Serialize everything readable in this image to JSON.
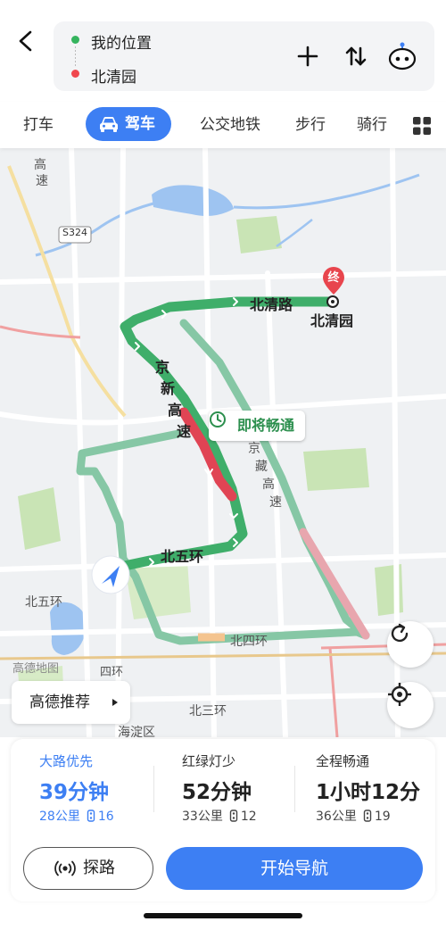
{
  "header": {
    "start": "我的位置",
    "end": "北清园"
  },
  "tabs": [
    {
      "label": "打车"
    },
    {
      "label": "驾车",
      "active": true
    },
    {
      "label": "公交地铁"
    },
    {
      "label": "步行"
    },
    {
      "label": "骑行"
    }
  ],
  "map": {
    "road_beiqing": "北清路",
    "destination": "北清园",
    "destination_marker": "终",
    "road_jingxin": [
      "京",
      "新",
      "高",
      "速"
    ],
    "road_jingzang": [
      "京",
      "藏",
      "高",
      "速"
    ],
    "road_beiwuhuan": "北五环",
    "road_beiwuhuan_left": "北五环",
    "road_beisihuan": "北四环",
    "road_beisanhuan": "北三环",
    "haidian": "海淀区",
    "sihuan_short": "四环",
    "expressway_top": [
      "高",
      "速"
    ],
    "s324": "S324",
    "watermark": "高德地图",
    "soon_clear": "即将畅通",
    "recommend": "高德推荐"
  },
  "routes": [
    {
      "name": "大路优先",
      "time": "39分钟",
      "distance": "28公里",
      "lights": "16",
      "selected": true
    },
    {
      "name": "红绿灯少",
      "time": "52分钟",
      "distance": "33公里",
      "lights": "12"
    },
    {
      "name": "全程畅通",
      "time": "1小时12分",
      "distance": "36公里",
      "lights": "19"
    }
  ],
  "actions": {
    "explore": "探路",
    "start_nav": "开始导航"
  },
  "colors": {
    "accent": "#3d7ff3",
    "route_green": "#3fae6a",
    "route_alt": "#86c7a5",
    "jam_red": "#e04454",
    "slow_pink": "#e8a6ae"
  }
}
